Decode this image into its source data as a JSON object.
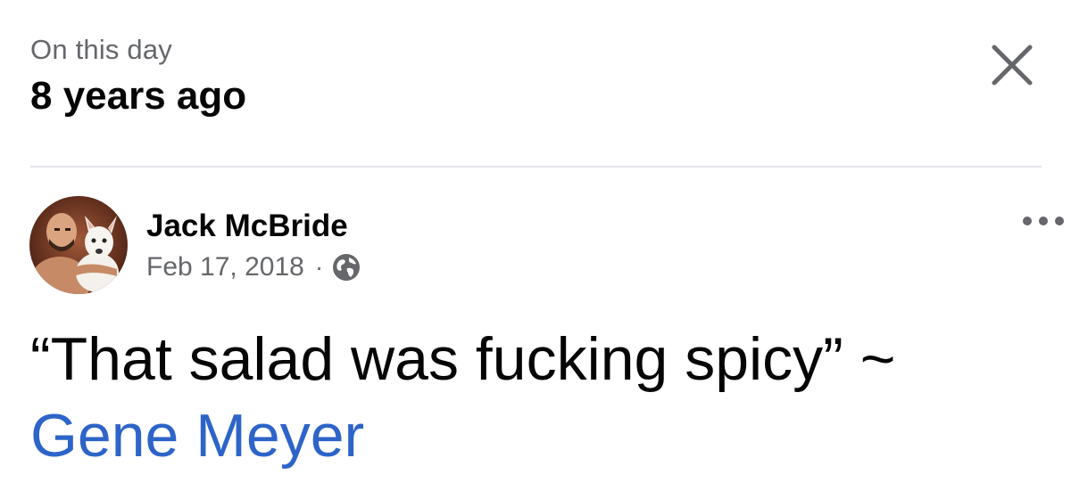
{
  "memory": {
    "kicker": "On this day",
    "title": "8 years ago"
  },
  "post": {
    "author": "Jack McBride",
    "date": "Feb 17, 2018",
    "separator": "·",
    "audience_icon": "globe-icon",
    "text": "“That salad was fucking spicy” ~",
    "mention": "Gene Meyer"
  },
  "icons": {
    "close": "close-icon",
    "more": "more-options-icon"
  },
  "colors": {
    "text_primary": "#050505",
    "text_secondary": "#65676b",
    "link": "#2d64c8",
    "divider": "#e4e6eb"
  }
}
